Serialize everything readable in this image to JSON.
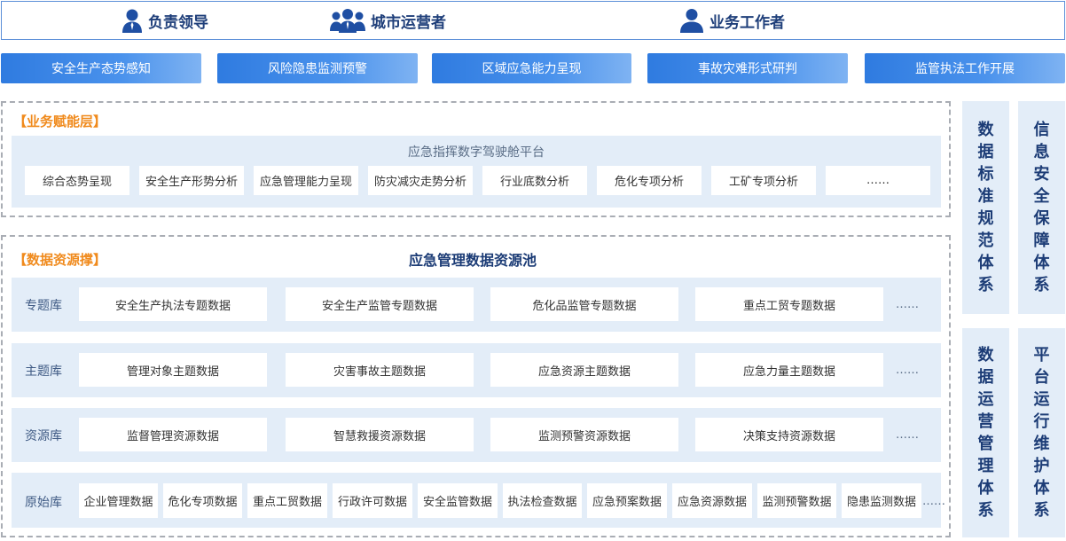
{
  "users": {
    "items": [
      {
        "label": "负责领导",
        "icon": "person-icon"
      },
      {
        "label": "城市运营者",
        "icon": "group-icon"
      },
      {
        "label": "业务工作者",
        "icon": "person-icon"
      }
    ]
  },
  "scenarios": [
    "安全生产态势感知",
    "风险隐患监测预警",
    "区域应急能力呈现",
    "事故灾难形式研判",
    "监管执法工作开展"
  ],
  "service_layer": {
    "title": "【业务赋能层】",
    "platform": "应急指挥数字驾驶舱平台",
    "items": [
      "综合态势呈现",
      "安全生产形势分析",
      "应急管理能力呈现",
      "防灾减灾走势分析",
      "行业底数分析",
      "危化专项分析",
      "工矿专项分析",
      "……"
    ]
  },
  "data_layer": {
    "title": "【数据资源撑】",
    "pool": "应急管理数据资源池",
    "rows": [
      {
        "label": "专题库",
        "items": [
          "安全生产执法专题数据",
          "安全生产监管专题数据",
          "危化品监管专题数据",
          "重点工贸专题数据"
        ],
        "more": "……"
      },
      {
        "label": "主题库",
        "items": [
          "管理对象主题数据",
          "灾害事故主题数据",
          "应急资源主题数据",
          "应急力量主题数据"
        ],
        "more": "……"
      },
      {
        "label": "资源库",
        "items": [
          "监督管理资源数据",
          "智慧救援资源数据",
          "监测预警资源数据",
          "决策支持资源数据"
        ],
        "more": "……"
      },
      {
        "label": "原始库",
        "items": [
          "企业管理数据",
          "危化专项数据",
          "重点工贸数据",
          "行政许可数据",
          "安全监管数据",
          "执法检查数据",
          "应急预案数据",
          "应急资源数据",
          "监测预警数据",
          "隐患监测数据"
        ],
        "more": "……"
      }
    ]
  },
  "pillars": [
    {
      "chars": [
        "数",
        "据",
        "标",
        "准",
        "规",
        "范",
        "体",
        "系"
      ]
    },
    {
      "chars": [
        "信",
        "息",
        "安",
        "全",
        "保",
        "障",
        "体",
        "系"
      ]
    },
    {
      "chars": [
        "数",
        "据",
        "运",
        "营",
        "管",
        "理",
        "体",
        "系"
      ]
    },
    {
      "chars": [
        "平",
        "台",
        "运",
        "行",
        "维",
        "护",
        "体",
        "系"
      ]
    }
  ],
  "colors": {
    "accent": "#2f7be0",
    "band": "#e3edf8",
    "heading": "#1c3c76",
    "layer_title": "#f08a1c"
  }
}
